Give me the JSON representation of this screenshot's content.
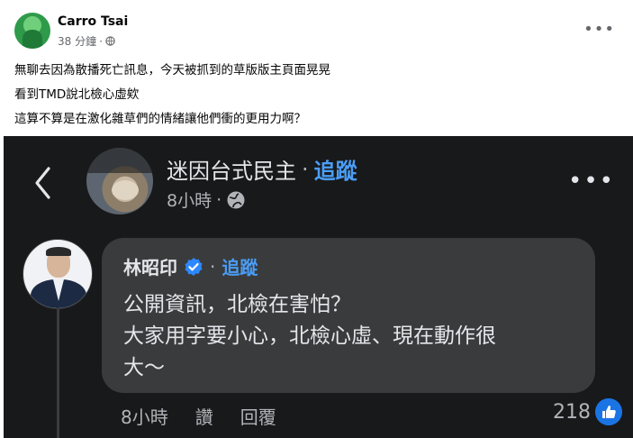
{
  "post": {
    "author": "Carro Tsai",
    "time": "38 分鐘",
    "separator": "·",
    "lines": [
      "無聊去因為散播死亡訊息，今天被抓到的草版版主頁面晃晃",
      "看到TMD說北檢心虛欸",
      "這算不算是在激化雜草們的情緒讓他們衝的更用力啊？"
    ],
    "more_icon": "more-horizontal-icon",
    "privacy_icon": "globe-icon"
  },
  "embedded": {
    "page_name": "迷因台式民主",
    "separator": "·",
    "follow_label": "追蹤",
    "time": "8小時",
    "comment": {
      "author": "林昭印",
      "follow_label": "追蹤",
      "lines": [
        "公開資訊，北檢在害怕？",
        "大家用字要小心，北檢心虛、現在動作很",
        "大～"
      ],
      "time": "8小時",
      "like_label": "讚",
      "reply_label": "回覆",
      "reaction_count": "218"
    }
  },
  "colors": {
    "dark_bg": "#18191a",
    "bubble_bg": "#3a3b3c",
    "accent_blue": "#4a9df5",
    "like_blue": "#1b74e4"
  }
}
